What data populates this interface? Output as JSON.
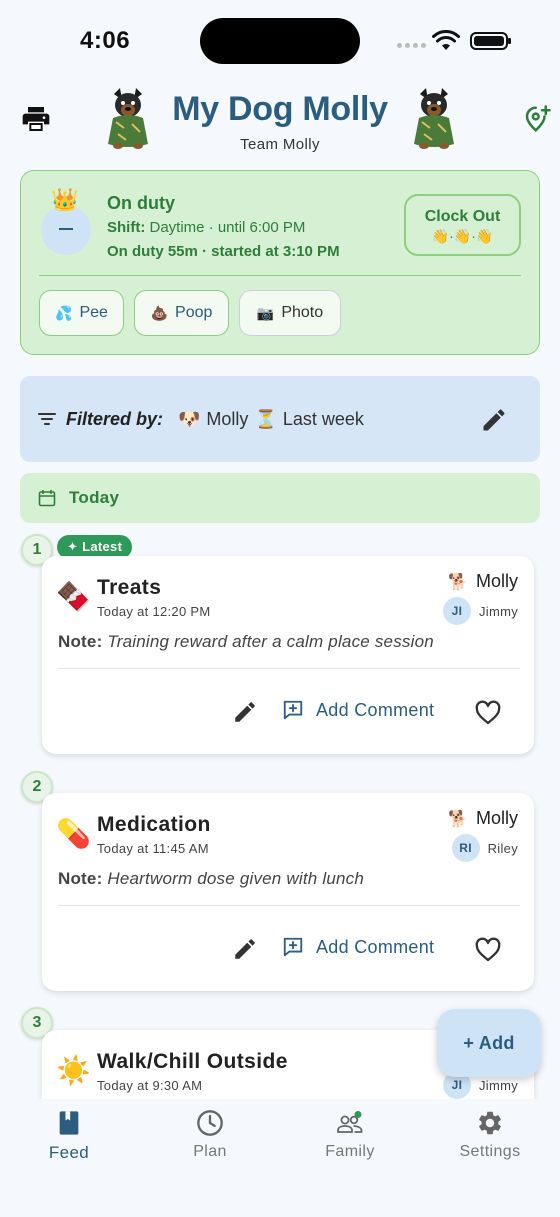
{
  "status_bar": {
    "time": "4:06"
  },
  "header": {
    "title": "My Dog Molly",
    "subtitle": "Team Molly"
  },
  "duty": {
    "title": "On duty",
    "crown": "👑",
    "shift_label": "Shift:",
    "shift_value": "Daytime · until 6:00 PM",
    "since": "On duty 55m · started at 3:10 PM",
    "clock_out_label": "Clock Out",
    "clock_out_emoji": "👋·👋·👋",
    "quick_actions": [
      {
        "icon": "💦",
        "label": "Pee"
      },
      {
        "icon": "💩",
        "label": "Poop"
      },
      {
        "icon": "📷",
        "label": "Photo"
      }
    ]
  },
  "filter": {
    "label": "Filtered by:",
    "dog_icon": "🐶",
    "dog": "Molly",
    "range_icon": "⏳",
    "range": "Last week"
  },
  "section": {
    "label": "Today"
  },
  "latest_badge": "✦ Latest",
  "entries": [
    {
      "index": "1",
      "icon": "🍫",
      "title": "Treats",
      "time": "Today at 12:20 PM",
      "dog_icon": "🐕",
      "dog": "Molly",
      "user_initials": "JI",
      "user": "Jimmy",
      "note_label": "Note:",
      "note": "Training reward after a calm place session",
      "add_comment": "Add Comment"
    },
    {
      "index": "2",
      "icon": "💊",
      "title": "Medication",
      "time": "Today at 11:45 AM",
      "dog_icon": "🐕",
      "dog": "Molly",
      "user_initials": "RI",
      "user": "Riley",
      "note_label": "Note:",
      "note": "Heartworm dose given with lunch",
      "add_comment": "Add Comment"
    },
    {
      "index": "3",
      "icon": "☀️",
      "title": "Walk/Chill Outside",
      "time": "Today at 9:30 AM",
      "user_initials": "JI",
      "user": "Jimmy"
    }
  ],
  "fab": {
    "label": "+ Add"
  },
  "tabs": [
    {
      "label": "Feed",
      "icon": "book-icon"
    },
    {
      "label": "Plan",
      "icon": "clock-icon"
    },
    {
      "label": "Family",
      "icon": "people-icon"
    },
    {
      "label": "Settings",
      "icon": "gear-icon"
    }
  ],
  "colors": {
    "brand": "#2b5d7e",
    "duty_green": "#2e7d3b",
    "duty_bg": "#d6f0d3",
    "filter_bg": "#d6e6f7",
    "latest_badge": "#2e9a59"
  }
}
